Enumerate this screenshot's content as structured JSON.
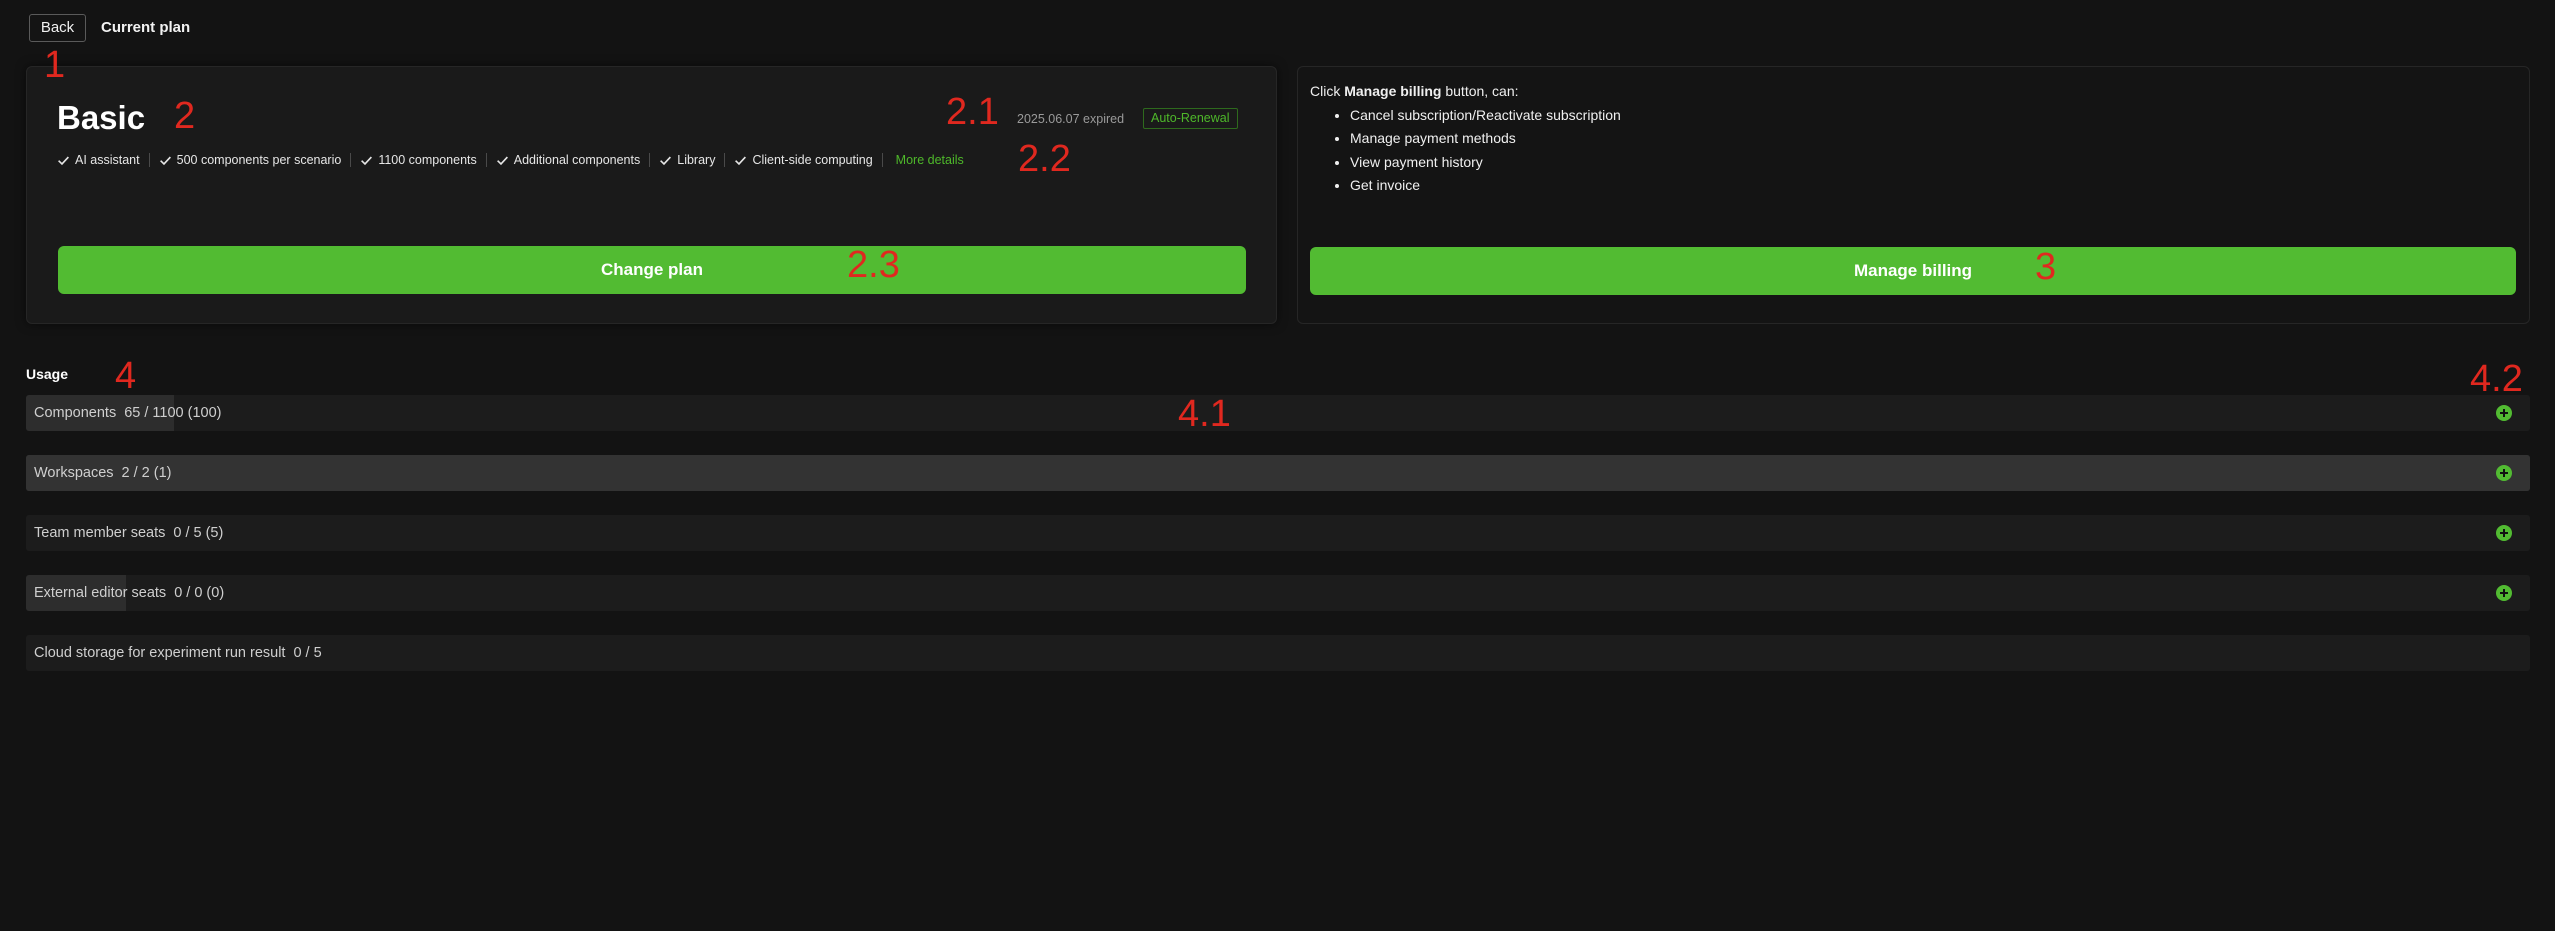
{
  "header": {
    "back_label": "Back",
    "title": "Current plan"
  },
  "plan": {
    "name": "Basic",
    "expiry": "2025.06.07 expired",
    "badge": "Auto-Renewal",
    "features": [
      "AI assistant",
      "500 components per scenario",
      "1100 components",
      "Additional components",
      "Library",
      "Client-side computing"
    ],
    "more_details": "More details",
    "change_plan_label": "Change plan"
  },
  "billing": {
    "intro_prefix": "Click ",
    "intro_bold": "Manage billing",
    "intro_suffix": " button, can:",
    "items": [
      "Cancel subscription/Reactivate subscription",
      "Manage payment methods",
      "View payment history",
      "Get invoice"
    ],
    "button_label": "Manage billing"
  },
  "usage": {
    "title": "Usage",
    "rows": [
      {
        "label": "Components",
        "value": "65 / 1100 (100)",
        "fill_fraction": 0.059,
        "addable": true
      },
      {
        "label": "Workspaces",
        "value": "2 / 2 (1)",
        "fill_fraction": 1.0,
        "addable": true
      },
      {
        "label": "Team member seats",
        "value": "0 / 5 (5)",
        "fill_fraction": 0.0,
        "addable": true
      },
      {
        "label": "External editor seats",
        "value": "0 / 0 (0)",
        "fill_fraction": 0.04,
        "addable": true
      },
      {
        "label": "Cloud storage for experiment run result",
        "value": "0 / 5",
        "fill_fraction": 0.0,
        "addable": false
      }
    ]
  },
  "annotations": [
    "1",
    "2",
    "2.1",
    "2.2",
    "2.3",
    "3",
    "4",
    "4.1",
    "4.2"
  ],
  "colors": {
    "accent": "#52bb32",
    "annotation": "#e0281f",
    "background": "#131313"
  }
}
